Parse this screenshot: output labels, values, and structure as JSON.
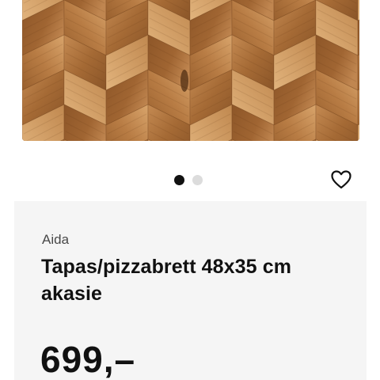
{
  "product": {
    "image_alt": "Tapas/pizzabrett 48x35 cm akasie",
    "brand": "Aida",
    "title": "Tapas/pizzabrett 48x35 cm akasie",
    "price": "699,–"
  },
  "carousel": {
    "dots": [
      {
        "active": true
      },
      {
        "active": false
      }
    ]
  },
  "icons": {
    "favorite": "heart-outline-icon"
  },
  "colors": {
    "wood_light": "#c98e55",
    "wood_mid": "#a86c36",
    "wood_dark": "#7a4a22",
    "card_background": "#f5f5f5",
    "text_primary": "#111111",
    "dot_inactive": "#dcdcdc"
  }
}
